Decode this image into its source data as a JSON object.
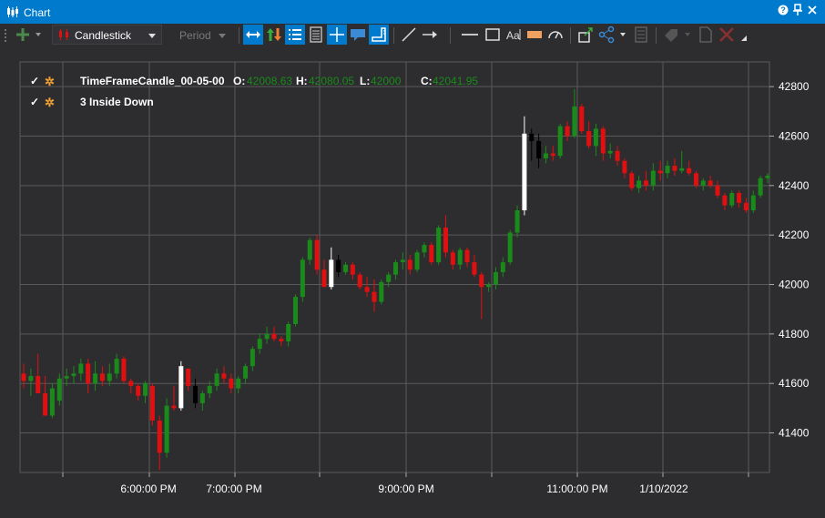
{
  "window": {
    "title": "Chart"
  },
  "toolbar": {
    "chart_type": "Candlestick",
    "period_placeholder": "Period"
  },
  "legend": {
    "series_name": "TimeFrameCandle_00-05-00",
    "open_label": "O:",
    "open_value": "42008.63",
    "high_label": "H:",
    "high_value": "42080.05",
    "low_label": "L:",
    "low_value": "42000",
    "close_label": "C:",
    "close_value": "42041.95",
    "indicator_name": "3 Inside Down"
  },
  "colors": {
    "up": "#1a8a1a",
    "down": "#e01010",
    "pattern_up": "#ffffff",
    "pattern_down": "#000000",
    "accent": "#007acc",
    "grid": "#5a5a5a"
  },
  "chart_data": {
    "type": "candlestick",
    "y_ticks": [
      42800,
      42600,
      42400,
      42200,
      42000,
      41800,
      41600,
      41400
    ],
    "x_labels": [
      "6:00:00 PM",
      "7:00:00 PM",
      "9:00:00 PM",
      "11:00:00 PM",
      "1/10/2022"
    ],
    "ylim": [
      41240,
      42900
    ],
    "candles": [
      [
        41640,
        41680,
        41580,
        41610,
        ""
      ],
      [
        41610,
        41660,
        41550,
        41630,
        ""
      ],
      [
        41630,
        41720,
        41560,
        41560,
        ""
      ],
      [
        41560,
        41630,
        41480,
        41470,
        ""
      ],
      [
        41470,
        41600,
        41460,
        41580,
        ""
      ],
      [
        41530,
        41640,
        41510,
        41620,
        ""
      ],
      [
        41620,
        41660,
        41590,
        41630,
        ""
      ],
      [
        41630,
        41670,
        41600,
        41640,
        ""
      ],
      [
        41640,
        41700,
        41610,
        41680,
        ""
      ],
      [
        41680,
        41700,
        41560,
        41600,
        ""
      ],
      [
        41600,
        41690,
        41570,
        41640,
        ""
      ],
      [
        41640,
        41670,
        41590,
        41610,
        ""
      ],
      [
        41610,
        41680,
        41590,
        41640,
        ""
      ],
      [
        41640,
        41720,
        41620,
        41700,
        ""
      ],
      [
        41700,
        41710,
        41600,
        41610,
        ""
      ],
      [
        41610,
        41620,
        41560,
        41590,
        ""
      ],
      [
        41590,
        41600,
        41530,
        41550,
        ""
      ],
      [
        41550,
        41610,
        41520,
        41600,
        ""
      ],
      [
        41590,
        41600,
        41430,
        41450,
        ""
      ],
      [
        41450,
        41470,
        41250,
        41320,
        ""
      ],
      [
        41320,
        41540,
        41300,
        41510,
        ""
      ],
      [
        41510,
        41590,
        41490,
        41500,
        ""
      ],
      [
        41500,
        41690,
        41490,
        41670,
        "pw"
      ],
      [
        41660,
        41660,
        41570,
        41590,
        ""
      ],
      [
        41590,
        41620,
        41500,
        41520,
        "pb"
      ],
      [
        41520,
        41570,
        41490,
        41560,
        ""
      ],
      [
        41560,
        41610,
        41540,
        41590,
        ""
      ],
      [
        41590,
        41660,
        41570,
        41640,
        ""
      ],
      [
        41640,
        41670,
        41600,
        41620,
        ""
      ],
      [
        41620,
        41640,
        41560,
        41580,
        ""
      ],
      [
        41580,
        41630,
        41560,
        41620,
        ""
      ],
      [
        41620,
        41680,
        41600,
        41670,
        ""
      ],
      [
        41670,
        41750,
        41650,
        41740,
        ""
      ],
      [
        41740,
        41800,
        41720,
        41780,
        ""
      ],
      [
        41780,
        41830,
        41760,
        41800,
        ""
      ],
      [
        41800,
        41830,
        41770,
        41780,
        ""
      ],
      [
        41780,
        41790,
        41750,
        41770,
        ""
      ],
      [
        41770,
        41850,
        41750,
        41840,
        ""
      ],
      [
        41840,
        41960,
        41830,
        41950,
        ""
      ],
      [
        41950,
        42110,
        41930,
        42100,
        ""
      ],
      [
        42100,
        42190,
        42080,
        42180,
        ""
      ],
      [
        42180,
        42200,
        42040,
        42060,
        ""
      ],
      [
        42060,
        42100,
        41990,
        41990,
        ""
      ],
      [
        41990,
        42150,
        41980,
        42100,
        "pw"
      ],
      [
        42100,
        42120,
        42030,
        42050,
        "pb"
      ],
      [
        42050,
        42090,
        42040,
        42080,
        ""
      ],
      [
        42080,
        42090,
        42020,
        42040,
        ""
      ],
      [
        42040,
        42050,
        41980,
        41990,
        ""
      ],
      [
        41990,
        42030,
        41950,
        41970,
        ""
      ],
      [
        41970,
        42020,
        41890,
        41930,
        ""
      ],
      [
        41930,
        42020,
        41920,
        42010,
        ""
      ],
      [
        42010,
        42050,
        41990,
        42040,
        ""
      ],
      [
        42040,
        42100,
        42020,
        42090,
        ""
      ],
      [
        42090,
        42130,
        42060,
        42100,
        ""
      ],
      [
        42100,
        42120,
        42040,
        42060,
        ""
      ],
      [
        42060,
        42140,
        42050,
        42130,
        ""
      ],
      [
        42130,
        42170,
        42110,
        42160,
        ""
      ],
      [
        42160,
        42170,
        42080,
        42090,
        ""
      ],
      [
        42090,
        42240,
        42080,
        42230,
        ""
      ],
      [
        42230,
        42280,
        42110,
        42130,
        ""
      ],
      [
        42130,
        42140,
        42060,
        42080,
        ""
      ],
      [
        42080,
        42150,
        42060,
        42140,
        ""
      ],
      [
        42140,
        42150,
        42070,
        42090,
        ""
      ],
      [
        42090,
        42120,
        42030,
        42040,
        ""
      ],
      [
        42040,
        42050,
        41860,
        41990,
        ""
      ],
      [
        41990,
        42010,
        41970,
        42000,
        ""
      ],
      [
        42000,
        42070,
        41980,
        42050,
        ""
      ],
      [
        42050,
        42110,
        42030,
        42090,
        ""
      ],
      [
        42090,
        42220,
        42080,
        42210,
        ""
      ],
      [
        42210,
        42320,
        42190,
        42300,
        ""
      ],
      [
        42300,
        42680,
        42280,
        42610,
        "pw"
      ],
      [
        42610,
        42630,
        42500,
        42580,
        "pb"
      ],
      [
        42580,
        42610,
        42470,
        42510,
        "pb"
      ],
      [
        42510,
        42560,
        42490,
        42530,
        ""
      ],
      [
        42530,
        42560,
        42500,
        42520,
        ""
      ],
      [
        42520,
        42650,
        42510,
        42640,
        ""
      ],
      [
        42640,
        42660,
        42580,
        42600,
        ""
      ],
      [
        42600,
        42790,
        42590,
        42720,
        ""
      ],
      [
        42720,
        42730,
        42610,
        42620,
        ""
      ],
      [
        42620,
        42660,
        42550,
        42560,
        ""
      ],
      [
        42560,
        42650,
        42520,
        42630,
        ""
      ],
      [
        42630,
        42640,
        42500,
        42530,
        ""
      ],
      [
        42530,
        42570,
        42510,
        42540,
        ""
      ],
      [
        42540,
        42560,
        42480,
        42500,
        ""
      ],
      [
        42500,
        42510,
        42430,
        42450,
        ""
      ],
      [
        42450,
        42460,
        42380,
        42390,
        ""
      ],
      [
        42390,
        42440,
        42370,
        42420,
        ""
      ],
      [
        42420,
        42460,
        42380,
        42400,
        ""
      ],
      [
        42400,
        42490,
        42380,
        42460,
        ""
      ],
      [
        42460,
        42500,
        42420,
        42450,
        ""
      ],
      [
        42450,
        42500,
        42430,
        42480,
        ""
      ],
      [
        42480,
        42510,
        42440,
        42460,
        ""
      ],
      [
        42460,
        42540,
        42450,
        42470,
        ""
      ],
      [
        42470,
        42500,
        42440,
        42450,
        ""
      ],
      [
        42450,
        42460,
        42390,
        42400,
        ""
      ],
      [
        42400,
        42430,
        42380,
        42420,
        ""
      ],
      [
        42420,
        42440,
        42390,
        42400,
        ""
      ],
      [
        42400,
        42420,
        42350,
        42360,
        ""
      ],
      [
        42360,
        42370,
        42300,
        42320,
        ""
      ],
      [
        42320,
        42380,
        42310,
        42370,
        ""
      ],
      [
        42370,
        42380,
        42310,
        42330,
        ""
      ],
      [
        42330,
        42350,
        42290,
        42300,
        ""
      ],
      [
        42300,
        42380,
        42290,
        42360,
        ""
      ],
      [
        42360,
        42440,
        42350,
        42430,
        ""
      ],
      [
        42430,
        42450,
        42410,
        42440,
        ""
      ]
    ]
  }
}
